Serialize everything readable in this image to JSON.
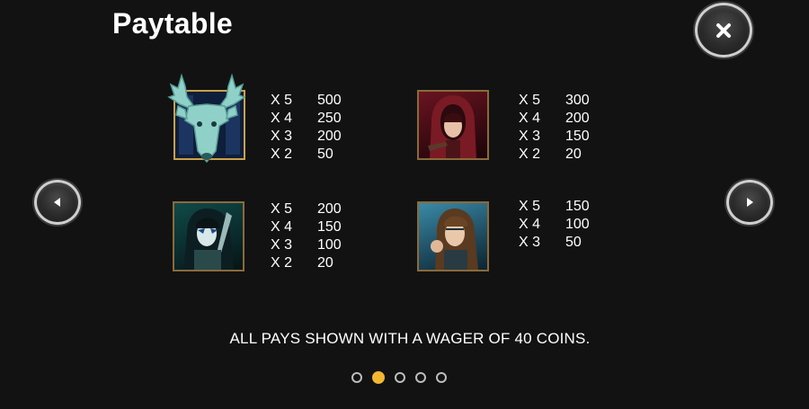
{
  "header": {
    "title": "Paytable"
  },
  "icons": {
    "close": "close-icon",
    "prev": "chevron-left-icon",
    "next": "chevron-right-icon"
  },
  "symbols": [
    {
      "name": "stag",
      "pays": [
        {
          "mult": "X 5",
          "value": "500"
        },
        {
          "mult": "X 4",
          "value": "250"
        },
        {
          "mult": "X 3",
          "value": "200"
        },
        {
          "mult": "X 2",
          "value": "50"
        }
      ]
    },
    {
      "name": "red-hood",
      "pays": [
        {
          "mult": "X 5",
          "value": "300"
        },
        {
          "mult": "X 4",
          "value": "200"
        },
        {
          "mult": "X 3",
          "value": "150"
        },
        {
          "mult": "X 2",
          "value": "20"
        }
      ]
    },
    {
      "name": "warrior",
      "pays": [
        {
          "mult": "X 5",
          "value": "200"
        },
        {
          "mult": "X 4",
          "value": "150"
        },
        {
          "mult": "X 3",
          "value": "100"
        },
        {
          "mult": "X 2",
          "value": "20"
        }
      ]
    },
    {
      "name": "archer",
      "pays": [
        {
          "mult": "X 5",
          "value": "150"
        },
        {
          "mult": "X 4",
          "value": "100"
        },
        {
          "mult": "X 3",
          "value": "50"
        }
      ]
    }
  ],
  "footer": {
    "note": "ALL PAYS SHOWN WITH A WAGER OF 40 COINS."
  },
  "pager": {
    "total": 5,
    "active_index": 1
  },
  "colors": {
    "background": "#121212",
    "text": "#ffffff",
    "active_dot": "#f2b632",
    "inactive_dot": "#bdbdbd",
    "frame_gold": "#c9a24a"
  }
}
